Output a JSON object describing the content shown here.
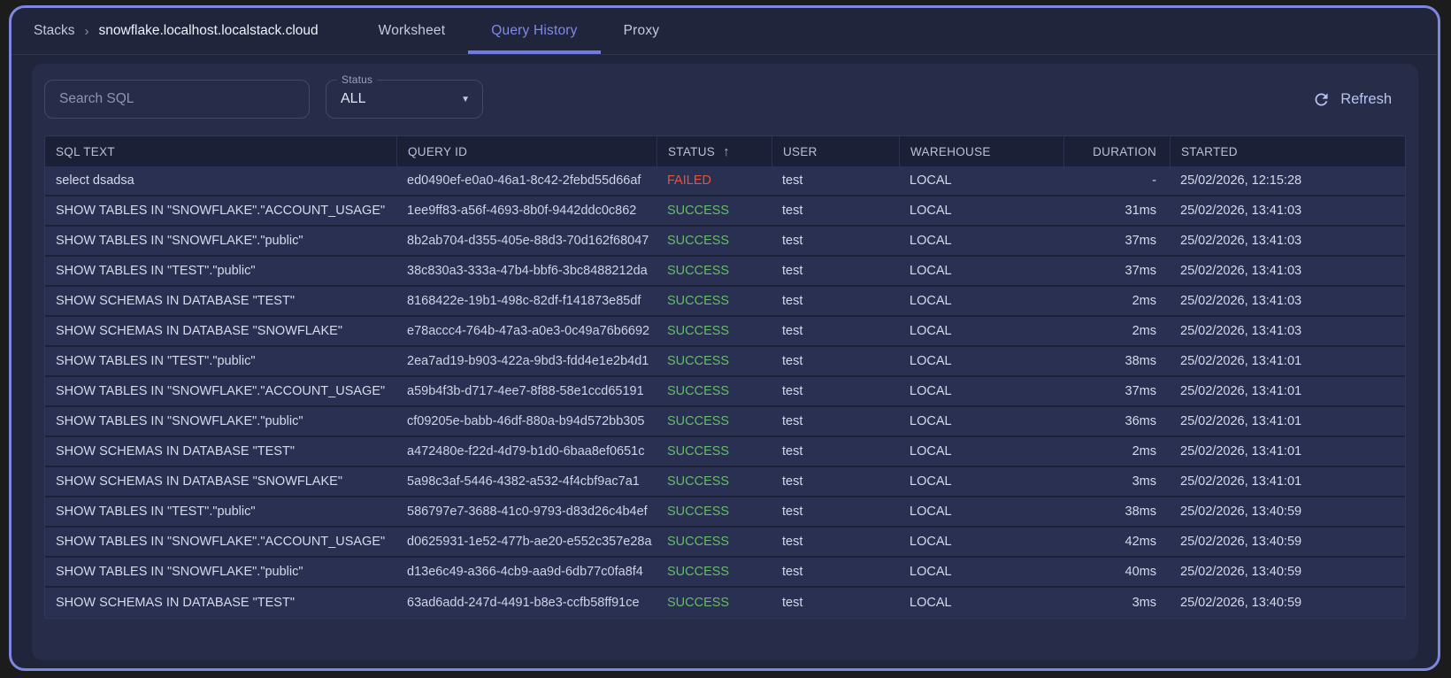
{
  "breadcrumb": {
    "root_label": "Stacks",
    "separator": "›",
    "stack_name": "snowflake.localhost.localstack.cloud"
  },
  "tabs": [
    {
      "label": "Worksheet",
      "active": false
    },
    {
      "label": "Query History",
      "active": true
    },
    {
      "label": "Proxy",
      "active": false
    }
  ],
  "filters": {
    "search_placeholder": "Search SQL",
    "status_label": "Status",
    "status_value": "ALL",
    "refresh_label": "Refresh"
  },
  "icons": {
    "dropdown_caret": "▼",
    "sort_asc": "↑"
  },
  "table": {
    "columns": [
      "SQL TEXT",
      "QUERY ID",
      "STATUS",
      "USER",
      "WAREHOUSE",
      "DURATION",
      "STARTED"
    ],
    "sort": {
      "column": "STATUS",
      "direction": "asc"
    },
    "rows": [
      {
        "sql": "select dsadsa",
        "query_id": "ed0490ef-e0a0-46a1-8c42-2febd55d66af",
        "status": "FAILED",
        "user": "test",
        "warehouse": "LOCAL",
        "duration": "-",
        "started": "25/02/2026, 12:15:28"
      },
      {
        "sql": "SHOW TABLES IN \"SNOWFLAKE\".\"ACCOUNT_USAGE\"",
        "query_id": "1ee9ff83-a56f-4693-8b0f-9442ddc0c862",
        "status": "SUCCESS",
        "user": "test",
        "warehouse": "LOCAL",
        "duration": "31ms",
        "started": "25/02/2026, 13:41:03"
      },
      {
        "sql": "SHOW TABLES IN \"SNOWFLAKE\".\"public\"",
        "query_id": "8b2ab704-d355-405e-88d3-70d162f68047",
        "status": "SUCCESS",
        "user": "test",
        "warehouse": "LOCAL",
        "duration": "37ms",
        "started": "25/02/2026, 13:41:03"
      },
      {
        "sql": "SHOW TABLES IN \"TEST\".\"public\"",
        "query_id": "38c830a3-333a-47b4-bbf6-3bc8488212da",
        "status": "SUCCESS",
        "user": "test",
        "warehouse": "LOCAL",
        "duration": "37ms",
        "started": "25/02/2026, 13:41:03"
      },
      {
        "sql": "SHOW SCHEMAS IN DATABASE \"TEST\"",
        "query_id": "8168422e-19b1-498c-82df-f141873e85df",
        "status": "SUCCESS",
        "user": "test",
        "warehouse": "LOCAL",
        "duration": "2ms",
        "started": "25/02/2026, 13:41:03"
      },
      {
        "sql": "SHOW SCHEMAS IN DATABASE \"SNOWFLAKE\"",
        "query_id": "e78accc4-764b-47a3-a0e3-0c49a76b6692",
        "status": "SUCCESS",
        "user": "test",
        "warehouse": "LOCAL",
        "duration": "2ms",
        "started": "25/02/2026, 13:41:03"
      },
      {
        "sql": "SHOW TABLES IN \"TEST\".\"public\"",
        "query_id": "2ea7ad19-b903-422a-9bd3-fdd4e1e2b4d1",
        "status": "SUCCESS",
        "user": "test",
        "warehouse": "LOCAL",
        "duration": "38ms",
        "started": "25/02/2026, 13:41:01"
      },
      {
        "sql": "SHOW TABLES IN \"SNOWFLAKE\".\"ACCOUNT_USAGE\"",
        "query_id": "a59b4f3b-d717-4ee7-8f88-58e1ccd65191",
        "status": "SUCCESS",
        "user": "test",
        "warehouse": "LOCAL",
        "duration": "37ms",
        "started": "25/02/2026, 13:41:01"
      },
      {
        "sql": "SHOW TABLES IN \"SNOWFLAKE\".\"public\"",
        "query_id": "cf09205e-babb-46df-880a-b94d572bb305",
        "status": "SUCCESS",
        "user": "test",
        "warehouse": "LOCAL",
        "duration": "36ms",
        "started": "25/02/2026, 13:41:01"
      },
      {
        "sql": "SHOW SCHEMAS IN DATABASE \"TEST\"",
        "query_id": "a472480e-f22d-4d79-b1d0-6baa8ef0651c",
        "status": "SUCCESS",
        "user": "test",
        "warehouse": "LOCAL",
        "duration": "2ms",
        "started": "25/02/2026, 13:41:01"
      },
      {
        "sql": "SHOW SCHEMAS IN DATABASE \"SNOWFLAKE\"",
        "query_id": "5a98c3af-5446-4382-a532-4f4cbf9ac7a1",
        "status": "SUCCESS",
        "user": "test",
        "warehouse": "LOCAL",
        "duration": "3ms",
        "started": "25/02/2026, 13:41:01"
      },
      {
        "sql": "SHOW TABLES IN \"TEST\".\"public\"",
        "query_id": "586797e7-3688-41c0-9793-d83d26c4b4ef",
        "status": "SUCCESS",
        "user": "test",
        "warehouse": "LOCAL",
        "duration": "38ms",
        "started": "25/02/2026, 13:40:59"
      },
      {
        "sql": "SHOW TABLES IN \"SNOWFLAKE\".\"ACCOUNT_USAGE\"",
        "query_id": "d0625931-1e52-477b-ae20-e552c357e28a",
        "status": "SUCCESS",
        "user": "test",
        "warehouse": "LOCAL",
        "duration": "42ms",
        "started": "25/02/2026, 13:40:59"
      },
      {
        "sql": "SHOW TABLES IN \"SNOWFLAKE\".\"public\"",
        "query_id": "d13e6c49-a366-4cb9-aa9d-6db77c0fa8f4",
        "status": "SUCCESS",
        "user": "test",
        "warehouse": "LOCAL",
        "duration": "40ms",
        "started": "25/02/2026, 13:40:59"
      },
      {
        "sql": "SHOW SCHEMAS IN DATABASE \"TEST\"",
        "query_id": "63ad6add-247d-4491-b8e3-ccfb58ff91ce",
        "status": "SUCCESS",
        "user": "test",
        "warehouse": "LOCAL",
        "duration": "3ms",
        "started": "25/02/2026, 13:40:59"
      }
    ]
  },
  "colors": {
    "accent": "#7c87e0",
    "success": "#66bb6a",
    "failed": "#e5533f"
  }
}
